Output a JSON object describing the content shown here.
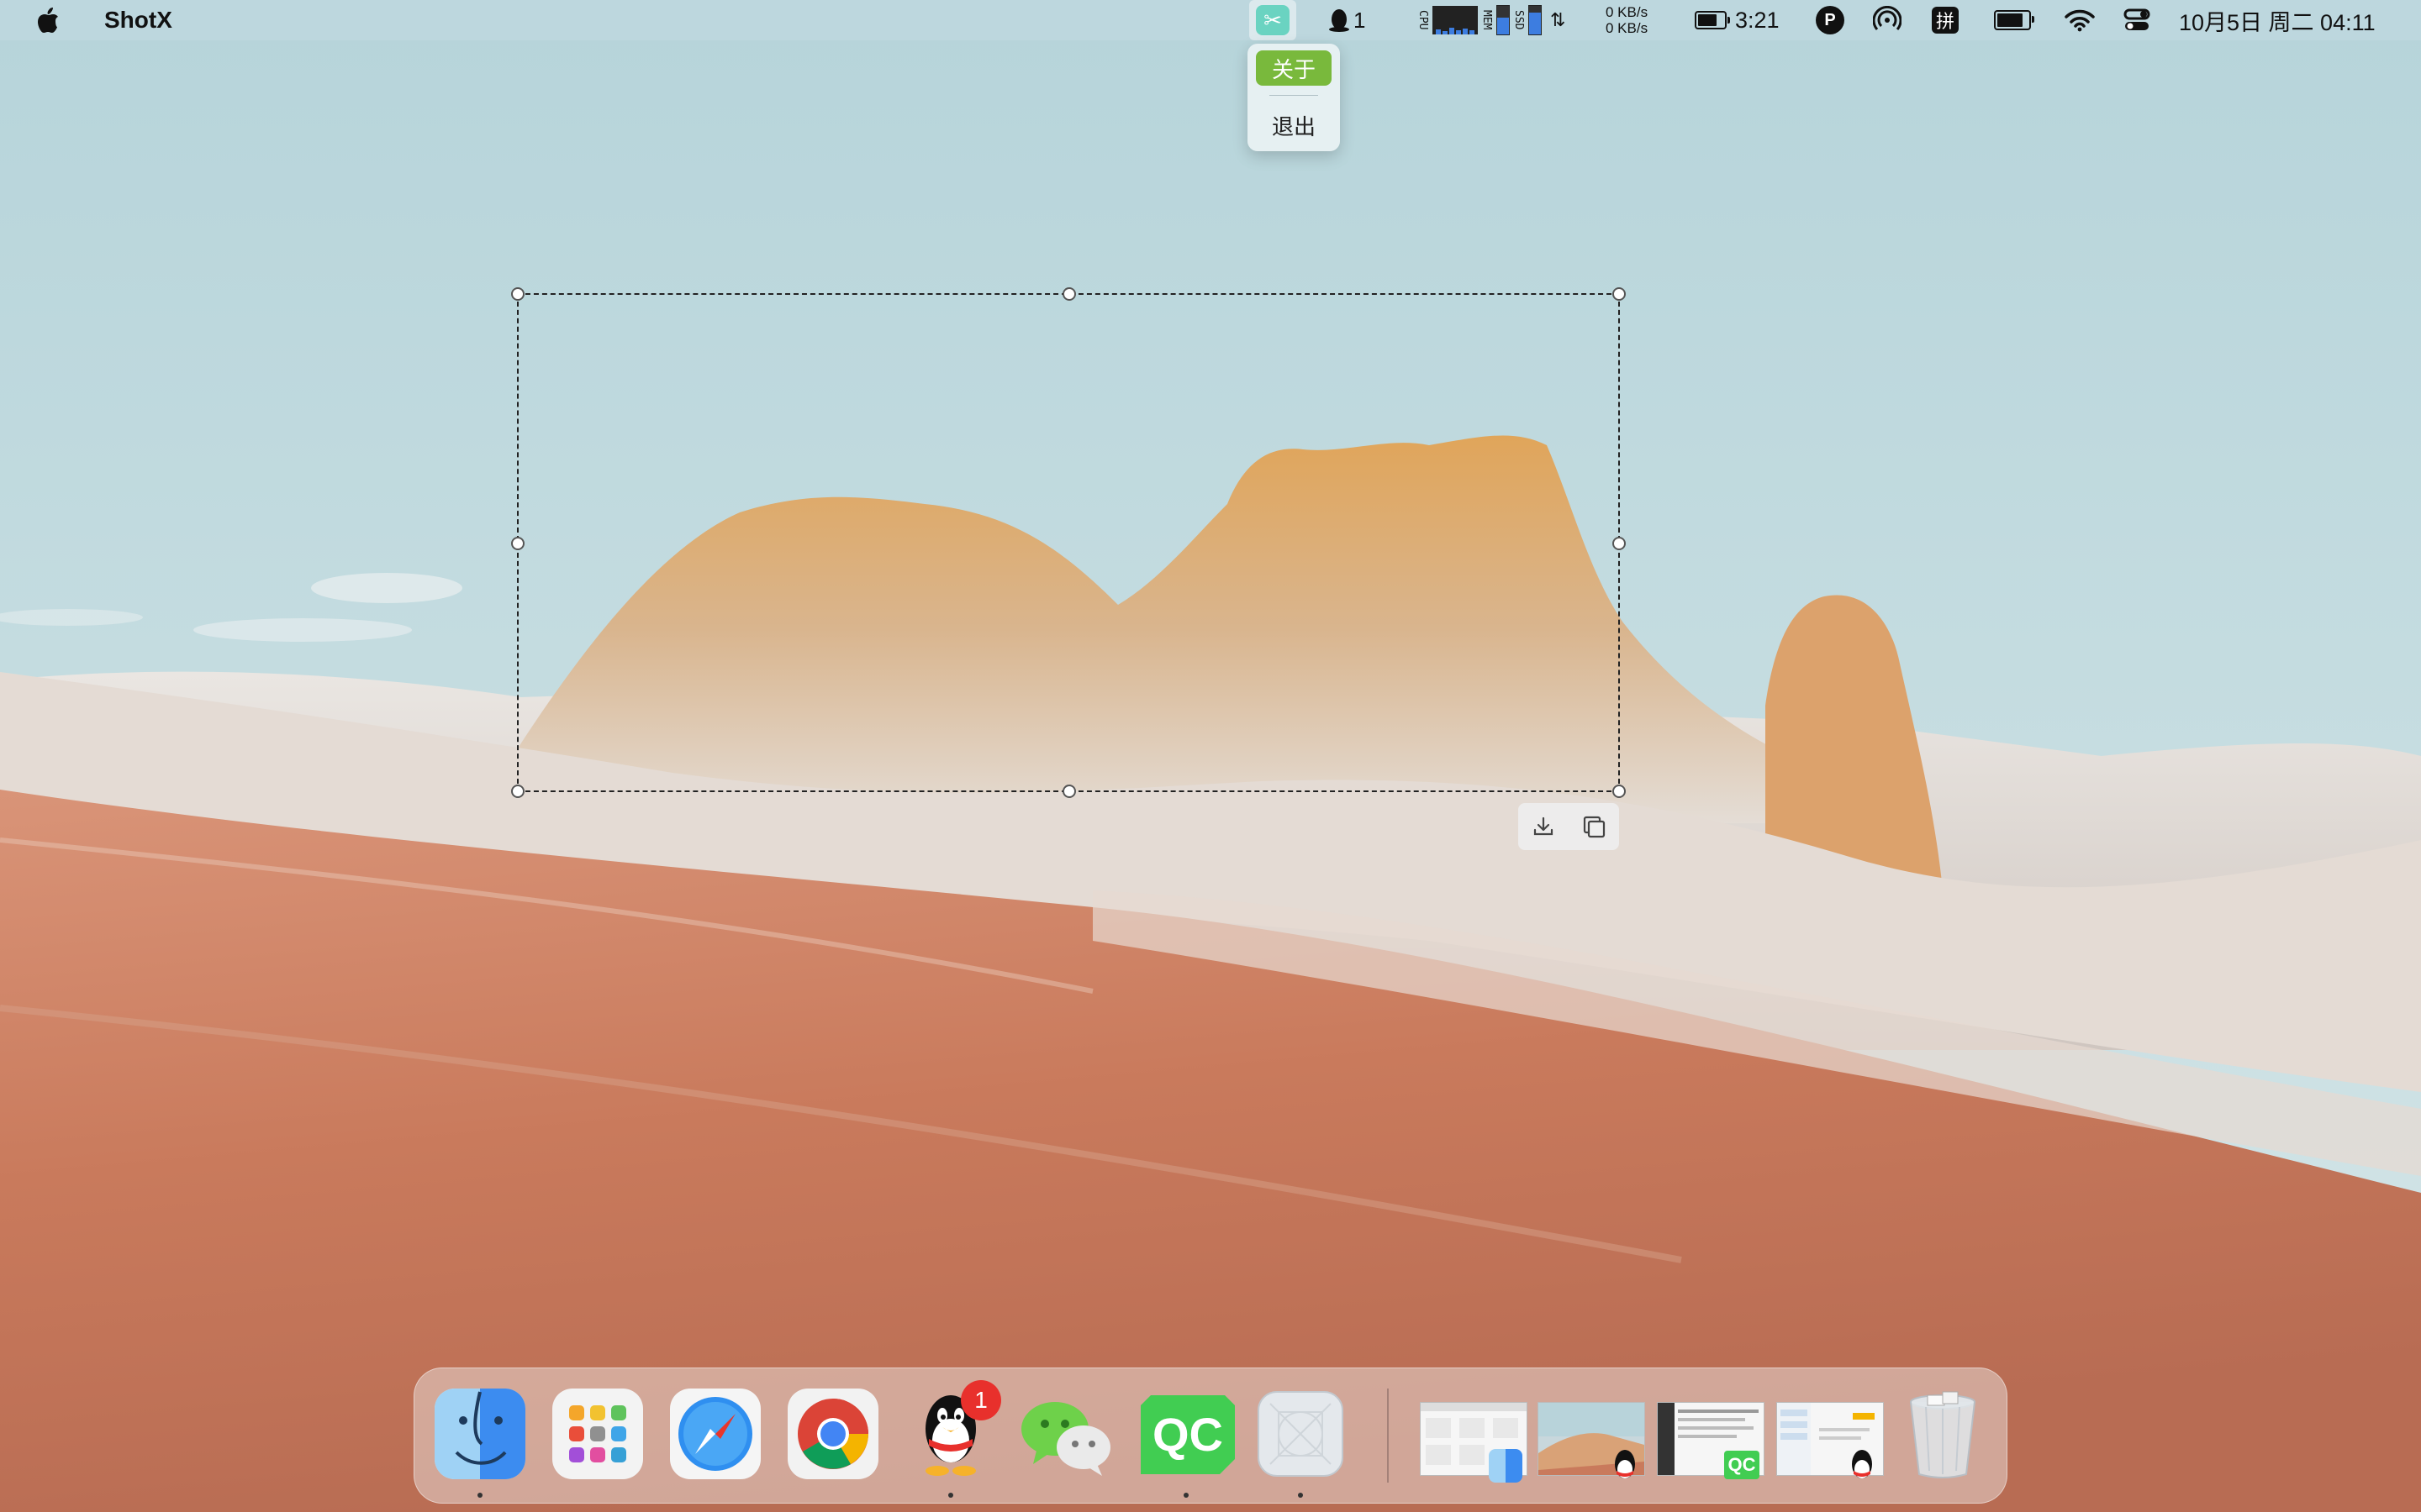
{
  "menubar": {
    "app_name": "ShotX",
    "qq_unread": "1",
    "stats": {
      "cpu_label": "CPU",
      "mem_label": "MEM",
      "ssd_label": "SSD"
    },
    "net_up": "0 KB/s",
    "net_down": "0 KB/s",
    "battery_time": "3:21",
    "ime_label": "拼",
    "datetime": "10月5日 周二 04:11"
  },
  "dropdown": {
    "items": [
      {
        "label": "关于",
        "active": true
      },
      {
        "label": "退出",
        "active": false
      }
    ]
  },
  "selection_toolbar": {
    "buttons": [
      {
        "icon": "download-icon"
      },
      {
        "icon": "copy-icon"
      }
    ]
  },
  "dock": {
    "apps": [
      {
        "name": "Finder",
        "icon": "finder-icon",
        "running": true
      },
      {
        "name": "Launchpad",
        "icon": "launchpad-icon",
        "running": false
      },
      {
        "name": "Safari",
        "icon": "safari-icon",
        "running": false
      },
      {
        "name": "Chrome",
        "icon": "chrome-icon",
        "running": false
      },
      {
        "name": "QQ",
        "icon": "qq-icon",
        "running": true,
        "badge": "1"
      },
      {
        "name": "WeChat",
        "icon": "wechat-icon",
        "running": false
      },
      {
        "name": "Qt Creator",
        "icon": "qt-creator-icon",
        "label": "QC",
        "running": true
      },
      {
        "name": "ShotX",
        "icon": "shotx-placeholder-icon",
        "running": true
      }
    ],
    "minimized_windows": [
      {
        "icon": "finder-window-thumbnail"
      },
      {
        "icon": "qq-window-thumbnail"
      },
      {
        "icon": "qt-creator-window-thumbnail",
        "label": "QC"
      },
      {
        "icon": "qq-chat-window-thumbnail"
      }
    ],
    "trash": {
      "icon": "trash-icon"
    }
  },
  "colors": {
    "menu_accent": "#79b93c",
    "badge_red": "#e8302c",
    "qt_green": "#41cd52",
    "shotx_teal": "#6ad3c1"
  }
}
